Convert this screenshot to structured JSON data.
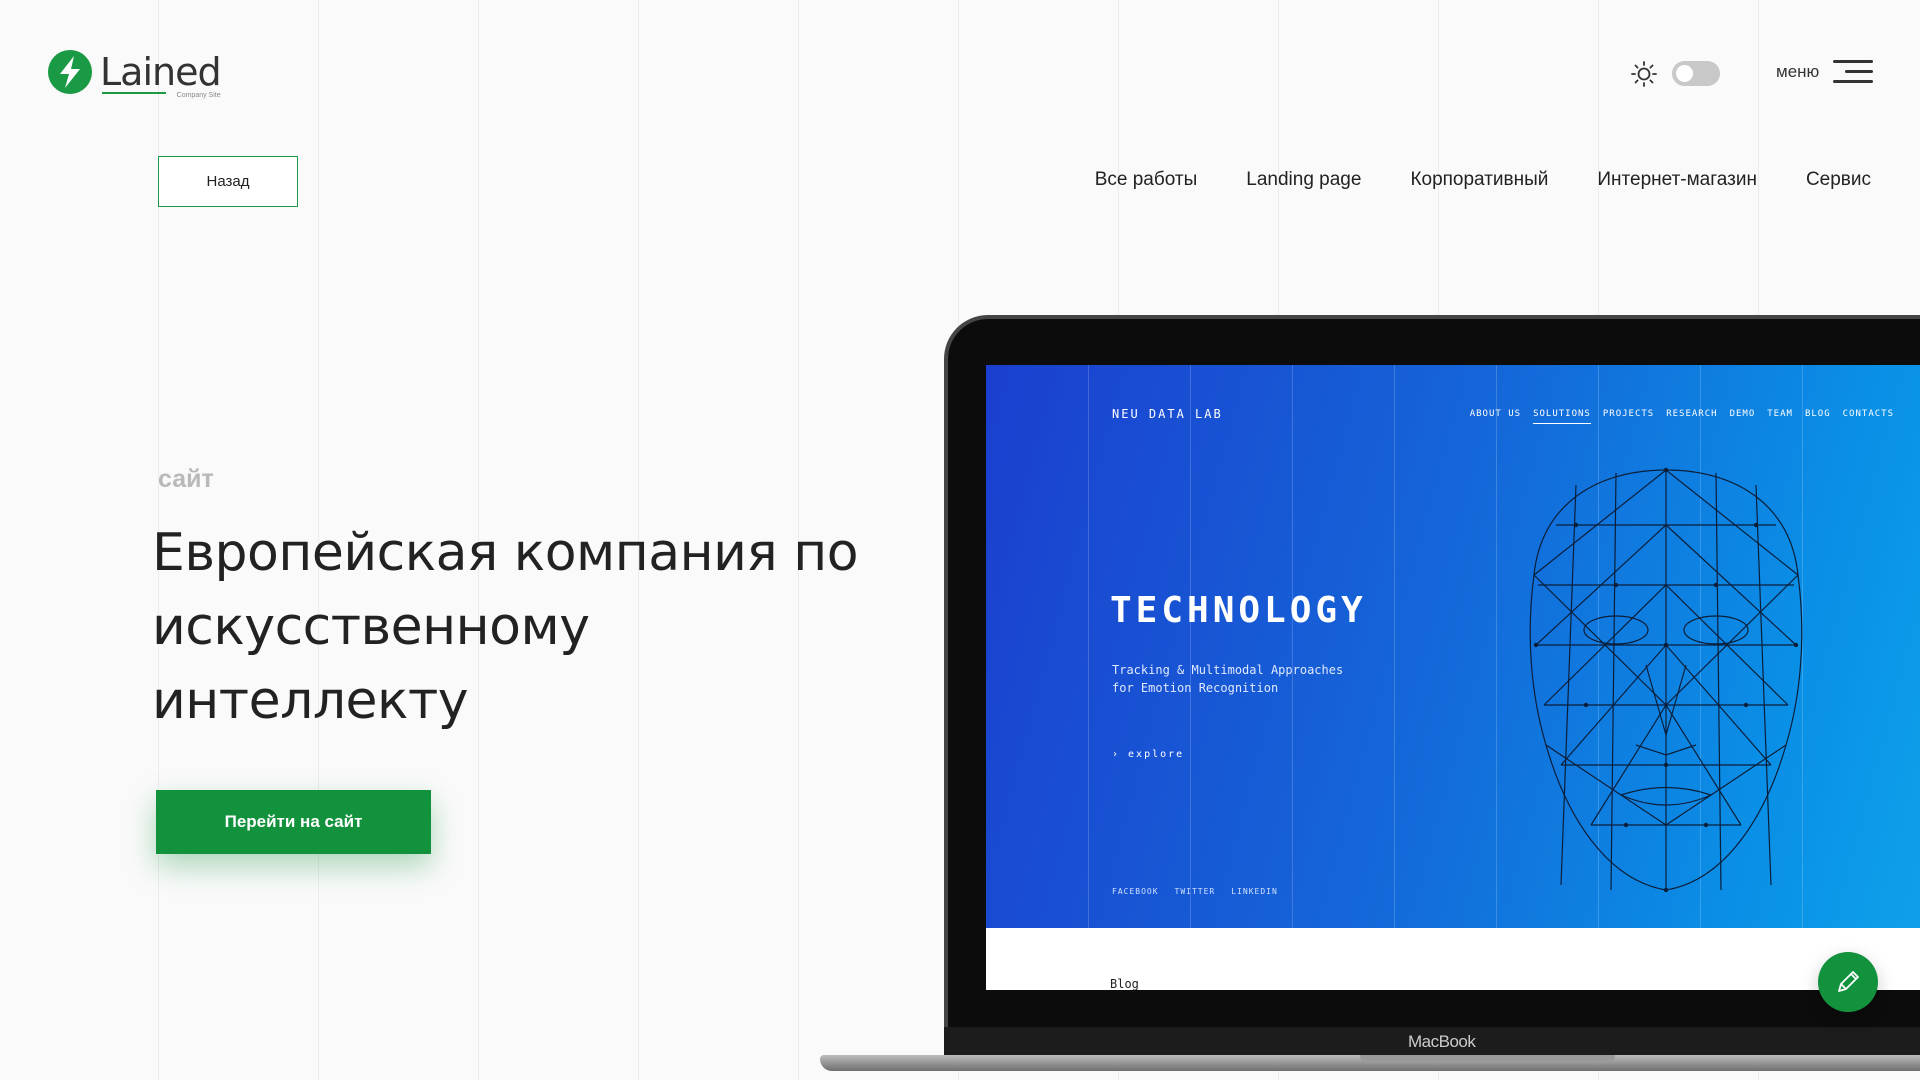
{
  "header": {
    "logo": {
      "name": "Lained",
      "tagline": "Company Site"
    },
    "theme_icon": "sun-icon",
    "menu_label": "меню",
    "menu_icon": "hamburger-icon"
  },
  "back_button": {
    "label": "Назад"
  },
  "filters": [
    {
      "label": "Все работы"
    },
    {
      "label": "Landing page"
    },
    {
      "label": "Корпоративный"
    },
    {
      "label": "Интернет-магазин"
    },
    {
      "label": "Сервис"
    }
  ],
  "hero": {
    "kicker": "сайт",
    "title": "Европейская компания по искусственному интеллекту",
    "cta_label": "Перейти на сайт"
  },
  "preview": {
    "site_logo": "NEU DATA LAB",
    "nav": [
      "ABOUT US",
      "SOLUTIONS",
      "PROJECTS",
      "RESEARCH",
      "DEMO",
      "TEAM",
      "BLOG",
      "CONTACTS"
    ],
    "nav_active": "SOLUTIONS",
    "headline": "TECHNOLOGY",
    "subtitle": "Tracking & Multimodal Approaches for Emotion Recognition",
    "explore": "› explore",
    "social": [
      "FACEBOOK",
      "TWITTER",
      "LINKEDIN"
    ],
    "blog": "Blog",
    "device_label": "MacBook"
  },
  "fab_icon": "pencil-icon",
  "colors": {
    "accent": "#13923d",
    "site_blue": "#1565d8"
  }
}
